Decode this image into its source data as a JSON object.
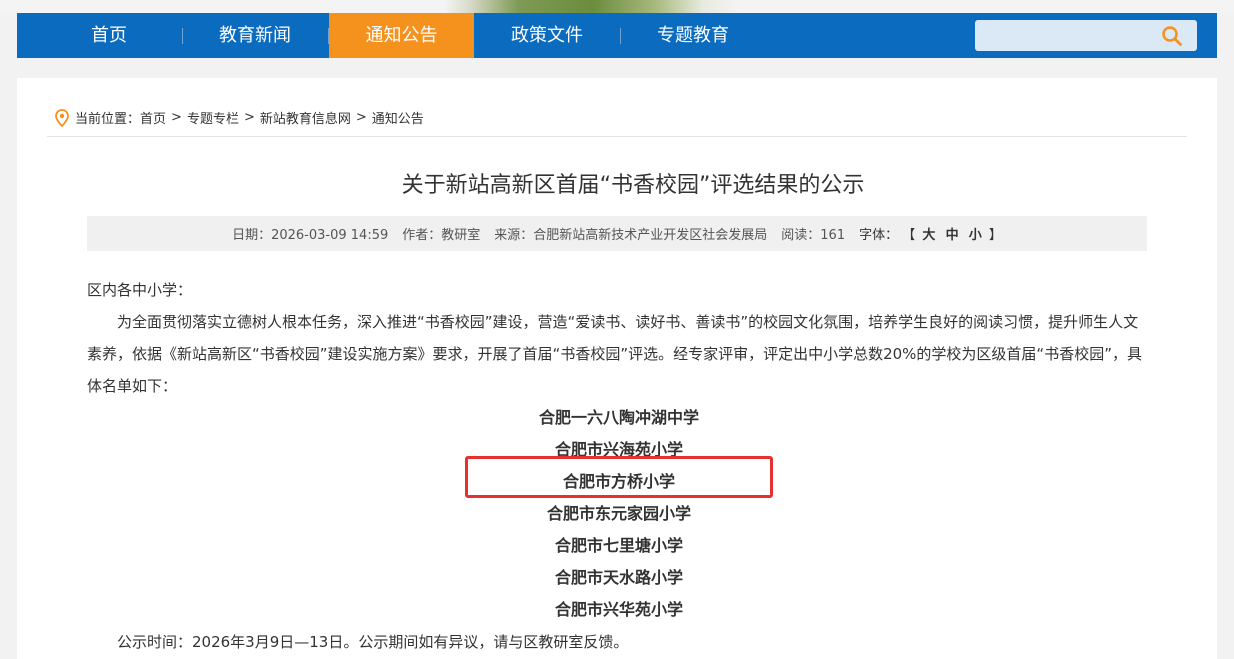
{
  "nav": {
    "items": [
      {
        "label": "首页",
        "active": false
      },
      {
        "label": "教育新闻",
        "active": false
      },
      {
        "label": "通知公告",
        "active": true
      },
      {
        "label": "政策文件",
        "active": false
      },
      {
        "label": "专题教育",
        "active": false
      }
    ],
    "search_placeholder": "",
    "colors": {
      "bar": "#0a6bbf",
      "active": "#f5921e"
    }
  },
  "breadcrumb": {
    "prefix": "当前位置：",
    "items": [
      "首页",
      "专题专栏",
      "新站教育信息网",
      "通知公告"
    ],
    "separator": ">"
  },
  "article": {
    "title": "关于新站高新区首届“书香校园”评选结果的公示",
    "meta": {
      "date_label": "日期：2026-03-09 14:59",
      "author_label": "作者：教研室",
      "source_label": "来源：合肥新站高新技术产业开发区社会发展局",
      "reads_label": "阅读：161",
      "font_label": "字体：",
      "font_open": "【",
      "font_sizes": [
        "大",
        "中",
        "小"
      ],
      "font_close": "】"
    },
    "salutation": "区内各中小学：",
    "paragraph": "为全面贯彻落实立德树人根本任务，深入推进“书香校园”建设，营造“爱读书、读好书、善读书”的校园文化氛围，培养学生良好的阅读习惯，提升师生人文素养，依据《新站高新区“书香校园”建设实施方案》要求，开展了首届“书香校园”评选。经专家评审，评定出中小学总数20%的学校为区级首届“书香校园”，具体名单如下：",
    "schools": [
      "合肥一六八陶冲湖中学",
      "合肥市兴海苑小学",
      "合肥市方桥小学",
      "合肥市东元家园小学",
      "合肥市七里塘小学",
      "合肥市天水路小学",
      "合肥市兴华苑小学"
    ],
    "footer": "公示时间：2026年3月9日—13日。公示期间如有异议，请与区教研室反馈。",
    "highlight_color": "#e5312f"
  }
}
